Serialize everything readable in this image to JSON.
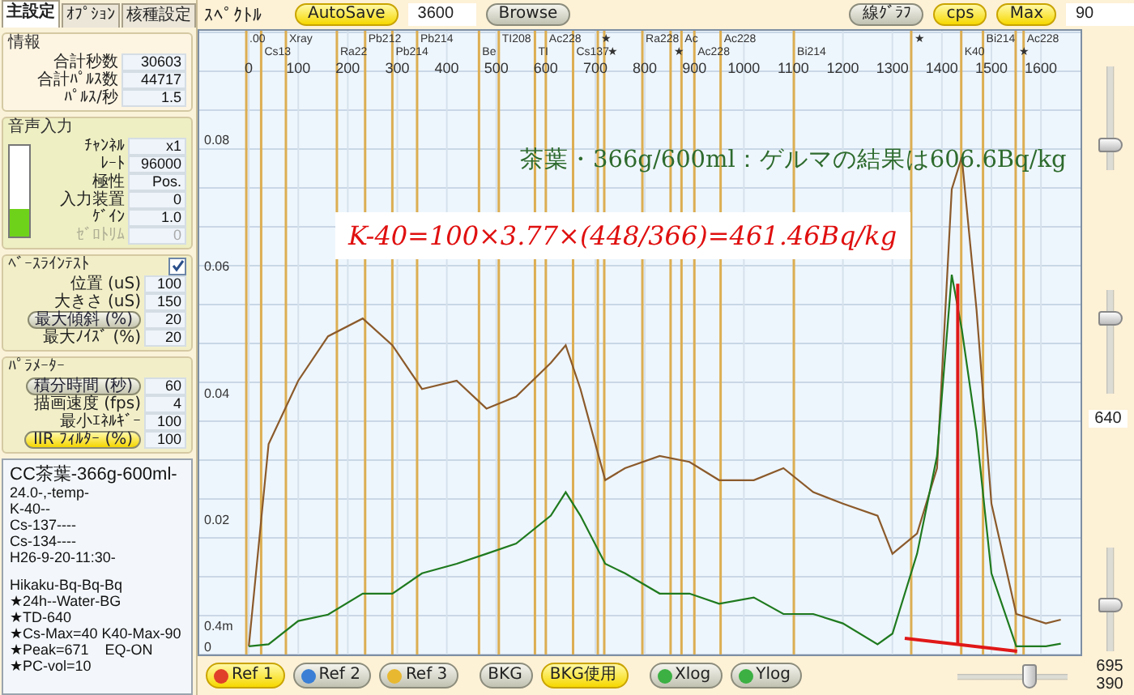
{
  "left_panel": {
    "tabs": [
      {
        "label": "主設定",
        "selected": true
      },
      {
        "label": "ｵﾌﾟｼｮﾝ",
        "selected": false
      },
      {
        "label": "核種設定",
        "selected": false
      }
    ],
    "groups": [
      {
        "kind": "info",
        "title": "情報",
        "rows": [
          {
            "kind": "field",
            "label": "合計秒数",
            "value": "30603",
            "disabled": false
          },
          {
            "kind": "field",
            "label": "合計ﾊﾟﾙｽ数",
            "value": "44717",
            "disabled": false
          },
          {
            "kind": "field",
            "label": "ﾊﾟﾙｽ/秒",
            "value": "1.5",
            "disabled": false
          }
        ]
      },
      {
        "kind": "audio",
        "title": "音声入力",
        "meter": {
          "level": 0.3
        },
        "rows": [
          {
            "kind": "field",
            "label": "ﾁｬﾝﾈﾙ",
            "value": "x1",
            "disabled": false
          },
          {
            "kind": "field",
            "label": "ﾚｰﾄ",
            "value": "96000",
            "disabled": false
          },
          {
            "kind": "field",
            "label": "極性",
            "value": "Pos.",
            "disabled": false
          },
          {
            "kind": "field",
            "label": "入力装置",
            "value": "0",
            "disabled": false
          },
          {
            "kind": "field",
            "label": "ｹﾞｲﾝ",
            "value": "1.0",
            "disabled": false
          },
          {
            "kind": "field",
            "label": "ｾﾞﾛﾄﾘﾑ",
            "value": "0",
            "disabled": true
          }
        ]
      },
      {
        "kind": "baseline",
        "title": "ﾍﾞｰｽﾗｲﾝﾃｽﾄ",
        "checked": true,
        "rows": [
          {
            "kind": "field",
            "label": "位置 (uS)",
            "value": "100",
            "disabled": false
          },
          {
            "kind": "field",
            "label": "大きさ (uS)",
            "value": "150",
            "disabled": false
          },
          {
            "kind": "button",
            "label": "最大傾斜 (%)",
            "value": "20",
            "on": false
          },
          {
            "kind": "field",
            "label": "最大ﾉｲｽﾞ (%)",
            "value": "20",
            "disabled": false
          }
        ]
      },
      {
        "kind": "params",
        "title": "ﾊﾟﾗﾒｰﾀｰ",
        "rows": [
          {
            "kind": "button",
            "label": "積分時間 (秒)",
            "value": "60",
            "on": false
          },
          {
            "kind": "field",
            "label": "描画速度 (fps)",
            "value": "4",
            "disabled": false
          },
          {
            "kind": "field",
            "label": "最小ｴﾈﾙｷﾞｰ",
            "value": "100",
            "disabled": false
          },
          {
            "kind": "button",
            "label": "IIR ﾌｨﾙﾀｰ (%)",
            "value": "100",
            "on": true
          }
        ]
      }
    ],
    "notes": [
      [
        "CC茶葉-366g-600ml-",
        "24.0-,-temp-",
        "K-40--",
        "Cs-137----",
        "Cs-134----",
        "H26-9-20-11:30-"
      ],
      [
        "Hikaku-Bq-Bq-Bq",
        "★24h--Water-BG",
        "★TD-640",
        "★Cs-Max=40 K40-Max-90",
        "★Peak=671    EQ-ON",
        "★PC-vol=10"
      ]
    ]
  },
  "header": {
    "title": "ｽﾍﾟｸﾄﾙ",
    "left_controls": [
      {
        "kind": "button",
        "label": "AutoSave",
        "on": true
      },
      {
        "kind": "field",
        "value": "3600"
      },
      {
        "kind": "button",
        "label": "Browse",
        "on": false
      }
    ],
    "right_controls": [
      {
        "kind": "button",
        "label": "線ｸﾞﾗﾌ",
        "on": false
      },
      {
        "kind": "button",
        "label": "cps",
        "on": true
      },
      {
        "kind": "button",
        "label": "Max",
        "on": true
      },
      {
        "kind": "field",
        "value": "90"
      }
    ]
  },
  "spectrum": {
    "chart_data": {
      "type": "line",
      "x": [
        0,
        40,
        100,
        160,
        230,
        290,
        350,
        420,
        480,
        540,
        610,
        640,
        670,
        720,
        760,
        830,
        890,
        950,
        1020,
        1080,
        1140,
        1200,
        1270,
        1300,
        1350,
        1390,
        1420,
        1440,
        1470,
        1500,
        1550,
        1610,
        1640
      ],
      "series": [
        {
          "color": "#8b5a2b",
          "values": [
            0,
            0.0319,
            0.0419,
            0.0489,
            0.0517,
            0.0475,
            0.0406,
            0.0419,
            0.0375,
            0.0394,
            0.0447,
            0.0475,
            0.0406,
            0.0262,
            0.0281,
            0.03,
            0.0291,
            0.0262,
            0.0262,
            0.0281,
            0.0243,
            0.0225,
            0.0206,
            0.0146,
            0.0178,
            0.0281,
            0.0721,
            0.0772,
            0.0531,
            0.0225,
            0.0051,
            0.0036,
            0.0042
          ]
        },
        {
          "color": "#1f7a1f",
          "values": [
            0,
            0.0003,
            0.004,
            0.005,
            0.0083,
            0.0083,
            0.0115,
            0.013,
            0.0146,
            0.0162,
            0.0206,
            0.0243,
            0.0206,
            0.013,
            0.0115,
            0.0083,
            0.0083,
            0.0067,
            0.0077,
            0.0051,
            0.0051,
            0.0036,
            0.0003,
            0.002,
            0.0146,
            0.03,
            0.0586,
            0.05,
            0.0338,
            0.0115,
            0,
            0,
            0.0004
          ]
        }
      ],
      "xlim": [
        -100,
        1680
      ],
      "ylim": [
        -0.0013,
        0.0971
      ],
      "grid": true,
      "xticks": [
        0,
        100,
        200,
        300,
        400,
        500,
        600,
        700,
        800,
        900,
        1000,
        1100,
        1200,
        1300,
        1400,
        1500,
        1600
      ],
      "yticks": [
        0,
        0.02,
        0.04,
        0.06,
        0.08
      ]
    },
    "floor_label": "0.4m",
    "markers": [
      ".00",
      "Cs13",
      "Xray",
      "Ra22",
      "Pb212",
      "Pb214",
      "Pb214",
      "Be",
      "TI208",
      "TI",
      "Ac228",
      "Cs137",
      "★",
      "★",
      "Ra228",
      "★",
      "Ac",
      "Ac228",
      "Ac228",
      "Bi214",
      "★",
      "K40",
      "Bi214",
      "★",
      "Ac228"
    ],
    "overlays": [
      {
        "kind": "caption",
        "text": "茶葉・366g/600ml：ゲルマの結果は606.6Bq/kg"
      },
      {
        "kind": "formula",
        "text": "K-40=100×3.77×(448/366)=461.46Bq/kg"
      }
    ]
  },
  "sliders": [
    {
      "level": 0.2
    },
    {
      "level": 0.77,
      "reading": "640"
    },
    {
      "level": 0.44
    }
  ],
  "bottom_bar": {
    "buttons": [
      {
        "label": "Ref 1",
        "on": true,
        "color": "#e0402a"
      },
      {
        "label": "Ref 2",
        "on": false,
        "color": "#3a7fd5"
      },
      {
        "label": "Ref 3",
        "on": false,
        "color": "#e8b830"
      },
      {
        "label": "BKG",
        "on": false
      },
      {
        "label": "BKG使用",
        "on": true
      },
      {
        "label": "Xlog",
        "on": false,
        "color": "#3cb043"
      },
      {
        "label": "Ylog",
        "on": false,
        "color": "#3cb043"
      }
    ],
    "slider": {
      "level": 0.68
    },
    "readings": [
      "695",
      "390"
    ]
  }
}
